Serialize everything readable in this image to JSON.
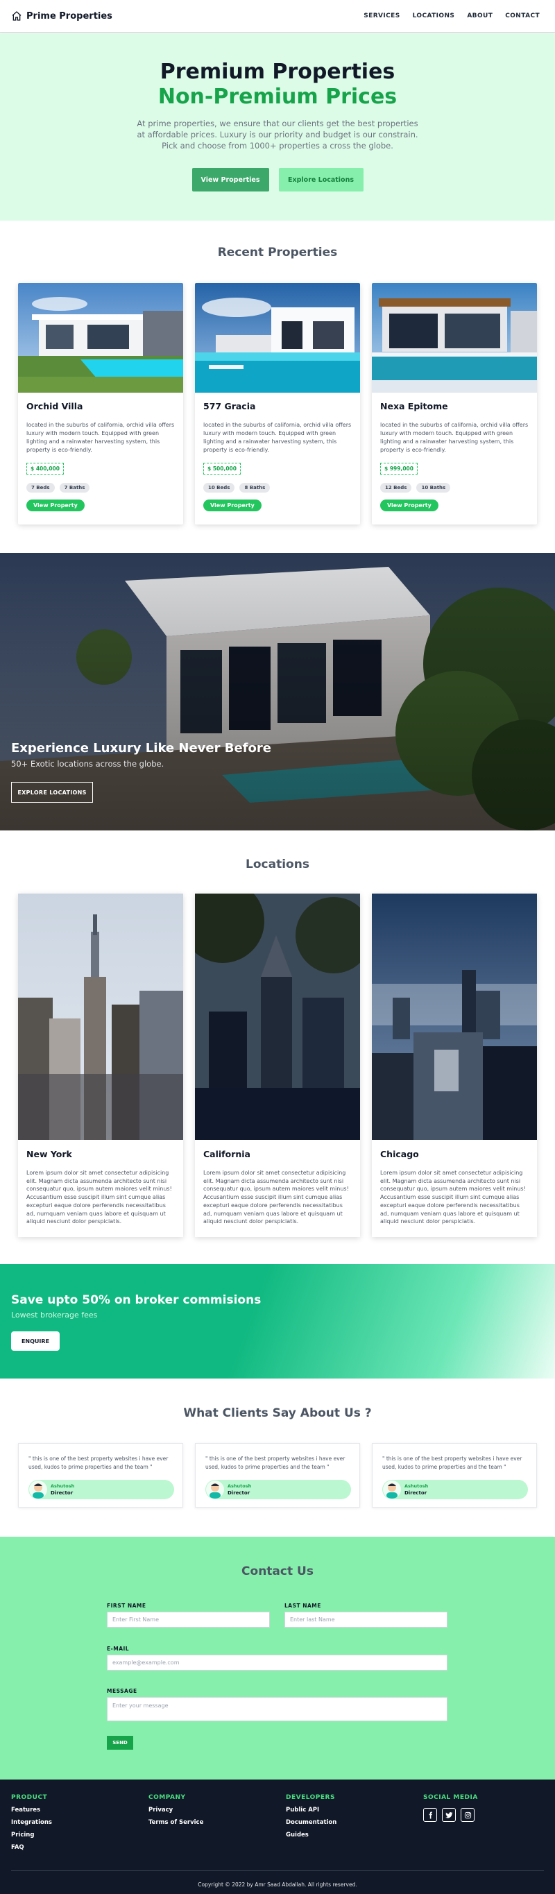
{
  "nav": {
    "brand": "Prime Properties",
    "links": [
      "SERVICES",
      "LOCATIONS",
      "ABOUT",
      "CONTACT"
    ]
  },
  "hero": {
    "title": "Premium Properties",
    "subtitle": "Non-Premium Prices",
    "description": "At prime properties, we ensure that our clients get the best properties at affordable prices. Luxury is our priority and budget is our constrain. Pick and choose from 1000+ properties a cross the globe.",
    "primary_button": "View Properties",
    "secondary_button": "Explore Locations"
  },
  "recent": {
    "title": "Recent Properties",
    "items": [
      {
        "name": "Orchid Villa",
        "description": "located in the suburbs of california, orchid villa offers luxury with modern touch. Equipped with green lighting and a rainwater harvesting system, this property is eco-friendly.",
        "price": "$ 400,000",
        "beds": "7 Beds",
        "baths": "7 Baths",
        "button": "View Property"
      },
      {
        "name": "577 Gracia",
        "description": "located in the suburbs of california, orchid villa offers luxury with modern touch. Equipped with green lighting and a rainwater harvesting system, this property is eco-friendly.",
        "price": "$ 500,000",
        "beds": "10 Beds",
        "baths": "8 Baths",
        "button": "View Property"
      },
      {
        "name": "Nexa Epitome",
        "description": "located in the suburbs of california, orchid villa offers luxury with modern touch. Equipped with green lighting and a rainwater harvesting system, this property is eco-friendly.",
        "price": "$ 999,000",
        "beds": "12 Beds",
        "baths": "10 Baths",
        "button": "View Property"
      }
    ]
  },
  "banner": {
    "title": "Experience Luxury Like Never Before",
    "subtitle": "50+ Exotic locations across the globe.",
    "button": "EXPLORE LOCATIONS"
  },
  "locations": {
    "title": "Locations",
    "items": [
      {
        "name": "New York",
        "description": "Lorem ipsum dolor sit amet consectetur adipisicing elit. Magnam dicta assumenda architecto sunt nisi consequatur quo, ipsum autem maiores velit minus! Accusantium esse suscipit illum sint cumque alias excepturi eaque dolore perferendis necessitatibus ad, numquam veniam quas labore et quisquam ut aliquid nesciunt dolor perspiciatis."
      },
      {
        "name": "California",
        "description": "Lorem ipsum dolor sit amet consectetur adipisicing elit. Magnam dicta assumenda architecto sunt nisi consequatur quo, ipsum autem maiores velit minus! Accusantium esse suscipit illum sint cumque alias excepturi eaque dolore perferendis necessitatibus ad, numquam veniam quas labore et quisquam ut aliquid nesciunt dolor perspiciatis."
      },
      {
        "name": "Chicago",
        "description": "Lorem ipsum dolor sit amet consectetur adipisicing elit. Magnam dicta assumenda architecto sunt nisi consequatur quo, ipsum autem maiores velit minus! Accusantium esse suscipit illum sint cumque alias excepturi eaque dolore perferendis necessitatibus ad, numquam veniam quas labore et quisquam ut aliquid nesciunt dolor perspiciatis."
      }
    ]
  },
  "promo": {
    "title": "Save upto 50% on broker commisions",
    "subtitle": "Lowest brokerage fees",
    "button": "ENQUIRE"
  },
  "testimonials": {
    "title": "What Clients Say About Us ?",
    "items": [
      {
        "quote": "\" this is one of the best property websites i have ever used, kudos to prime properties and the team \"",
        "name": "Ashutosh",
        "role": "Director"
      },
      {
        "quote": "\" this is one of the best property websites i have ever used, kudos to prime properties and the team \"",
        "name": "Ashutosh",
        "role": "Director"
      },
      {
        "quote": "\" this is one of the best property websites i have ever used, kudos to prime properties and the team \"",
        "name": "Ashutosh",
        "role": "Director"
      }
    ]
  },
  "contact": {
    "title": "Contact Us",
    "first_name_label": "FIRST NAME",
    "first_name_placeholder": "Enter First Name",
    "last_name_label": "LAST NAME",
    "last_name_placeholder": "Enter last Name",
    "email_label": "E-MAIL",
    "email_placeholder": "example@example.com",
    "message_label": "MESSAGE",
    "message_placeholder": "Enter your message",
    "send_button": "SEND"
  },
  "footer": {
    "columns": [
      {
        "heading": "PRODUCT",
        "links": [
          "Features",
          "Integrations",
          "Pricing",
          "FAQ"
        ]
      },
      {
        "heading": "COMPANY",
        "links": [
          "Privacy",
          "Terms of Service"
        ]
      },
      {
        "heading": "DEVELOPERS",
        "links": [
          "Public API",
          "Documentation",
          "Guides"
        ]
      }
    ],
    "social_heading": "SOCIAL MEDIA",
    "socials": [
      "facebook-icon",
      "twitter-icon",
      "instagram-icon"
    ],
    "copyright": "Copyright © 2022 by Amr Saad Abdallah. All rights reserved."
  },
  "colors": {
    "brand_green": "#16a34a",
    "hero_bg": "#dcfce7",
    "contact_bg": "#86efac",
    "footer_bg": "#111827"
  }
}
